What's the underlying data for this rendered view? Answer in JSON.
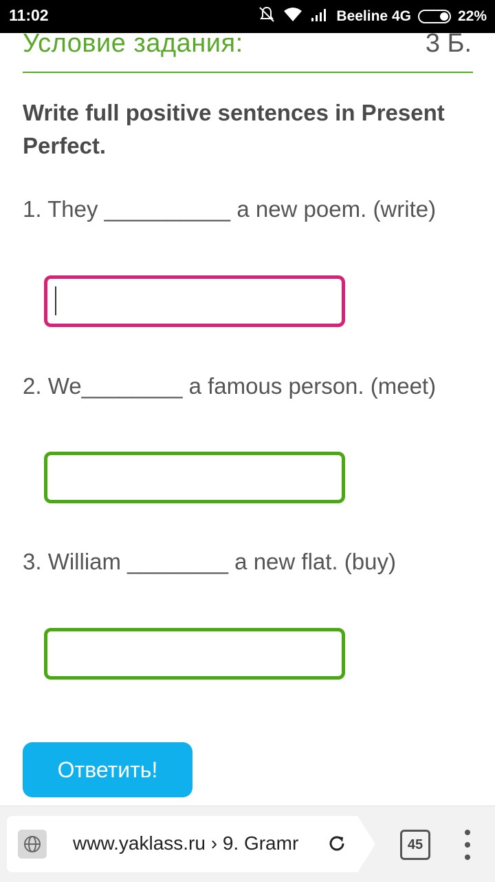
{
  "status_bar": {
    "time": "11:02",
    "carrier": "Beeline 4G",
    "battery": "22%",
    "icons": [
      "mute-bell-icon",
      "wifi-icon",
      "signal-icon",
      "battery-icon"
    ]
  },
  "task": {
    "title": "Условие задания:",
    "points": "3 Б.",
    "instruction": "Write full positive sentences in Present Perfect.",
    "questions": [
      {
        "text": "1. They __________ a new poem. (write)",
        "value": ""
      },
      {
        "text": "2. We________ a famous person. (meet)",
        "value": ""
      },
      {
        "text": "3. William ________ a new flat. (buy)",
        "value": ""
      }
    ],
    "submit_label": "Ответить!"
  },
  "browser": {
    "url": "www.yaklass.ru › 9. Gramr",
    "tabs_count": "45",
    "icons": [
      "globe-icon",
      "reload-icon",
      "tabs-icon",
      "menu-icon"
    ]
  },
  "colors": {
    "accent_green": "#5aa82a",
    "input_active": "#d6237a",
    "input_border": "#4aa813",
    "button": "#0fb0ec"
  }
}
